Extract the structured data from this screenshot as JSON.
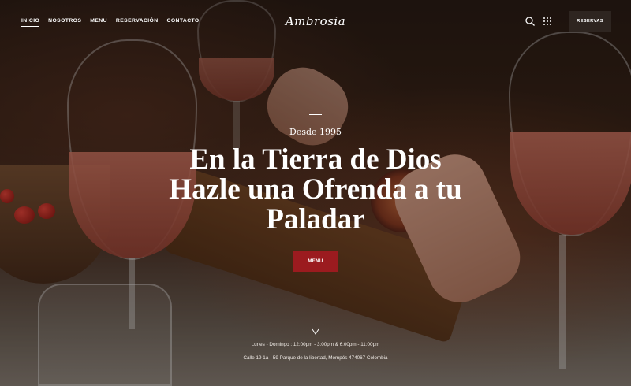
{
  "nav": {
    "items": [
      {
        "label": "INICIO",
        "active": true
      },
      {
        "label": "NOSOTROS",
        "active": false
      },
      {
        "label": "MENU",
        "active": false
      },
      {
        "label": "RESERVACIÓN",
        "active": false
      },
      {
        "label": "CONTACTO",
        "active": false
      }
    ],
    "logo": "Ambrosia",
    "search_icon": "search-icon",
    "grid_icon": "grid-menu-icon",
    "reservations_label": "RESERVAS"
  },
  "hero": {
    "kicker": "Desde 1995",
    "headline": "En la Tierra de Dios Hazle una Ofrenda a tu Paladar",
    "menu_button": "MENÚ",
    "scroll_icon": "chevron-down-icon",
    "hours": "Lunes - Domingo : 12:00pm - 3:00pm & 6:00pm - 11:00pm",
    "address": "Calle 19 1a - 59 Parque de la libertad, Mompós 474067 Colombia"
  },
  "colors": {
    "accent": "#9b1b1f",
    "dark_button": "#2e2520",
    "text": "#ffffff"
  }
}
